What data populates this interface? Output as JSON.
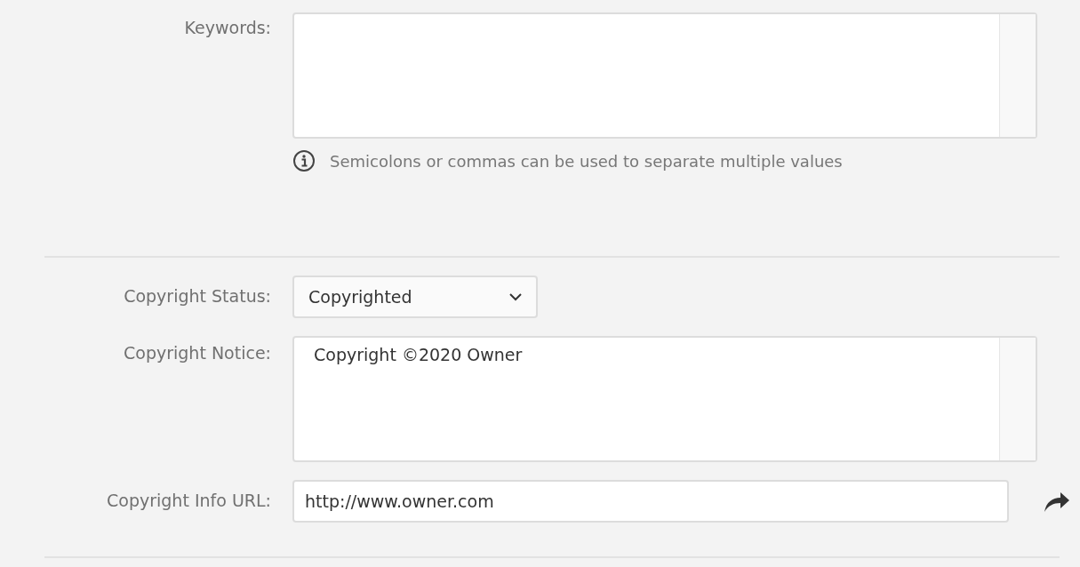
{
  "keywords": {
    "label": "Keywords:",
    "hint": "Semicolons or commas can be used to separate multiple values"
  },
  "copyright": {
    "status": {
      "label": "Copyright Status:",
      "value": "Copyrighted"
    },
    "notice": {
      "label": "Copyright Notice:",
      "value": "Copyright ©2020 Owner"
    },
    "url": {
      "label": "Copyright Info URL:",
      "value": "http://www.owner.com"
    }
  }
}
